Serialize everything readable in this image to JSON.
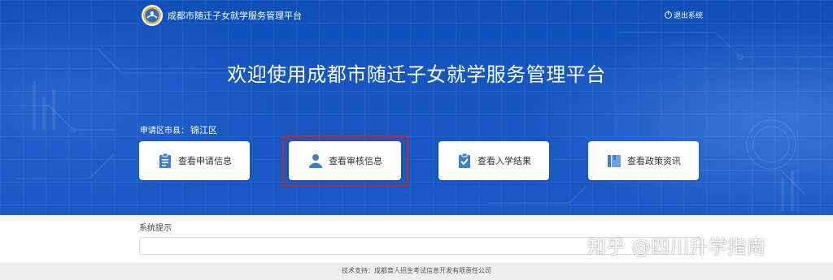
{
  "header": {
    "app_title": "成都市随迁子女就学服务管理平台",
    "logout_label": "退出系统"
  },
  "hero": {
    "welcome_title": "欢迎使用成都市随迁子女就学服务管理平台",
    "district_label": "申请区市县：",
    "district_value": "锦江区"
  },
  "cards": [
    {
      "label": "查看申请信息",
      "icon": "clipboard-icon"
    },
    {
      "label": "查看审核信息",
      "icon": "user-icon"
    },
    {
      "label": "查看入学结果",
      "icon": "checklist-icon"
    },
    {
      "label": "查看政策资讯",
      "icon": "book-icon"
    }
  ],
  "system_tips": {
    "label": "系统提示"
  },
  "footer": {
    "support_text": "技术支持：成都育人招生考试信息开发有限责任公司"
  },
  "watermark": {
    "text": "知乎 @四川升学指南"
  },
  "colors": {
    "hero_blue": "#1657c2",
    "icon_blue": "#3a7fd5",
    "highlight_red": "#c0292b"
  }
}
